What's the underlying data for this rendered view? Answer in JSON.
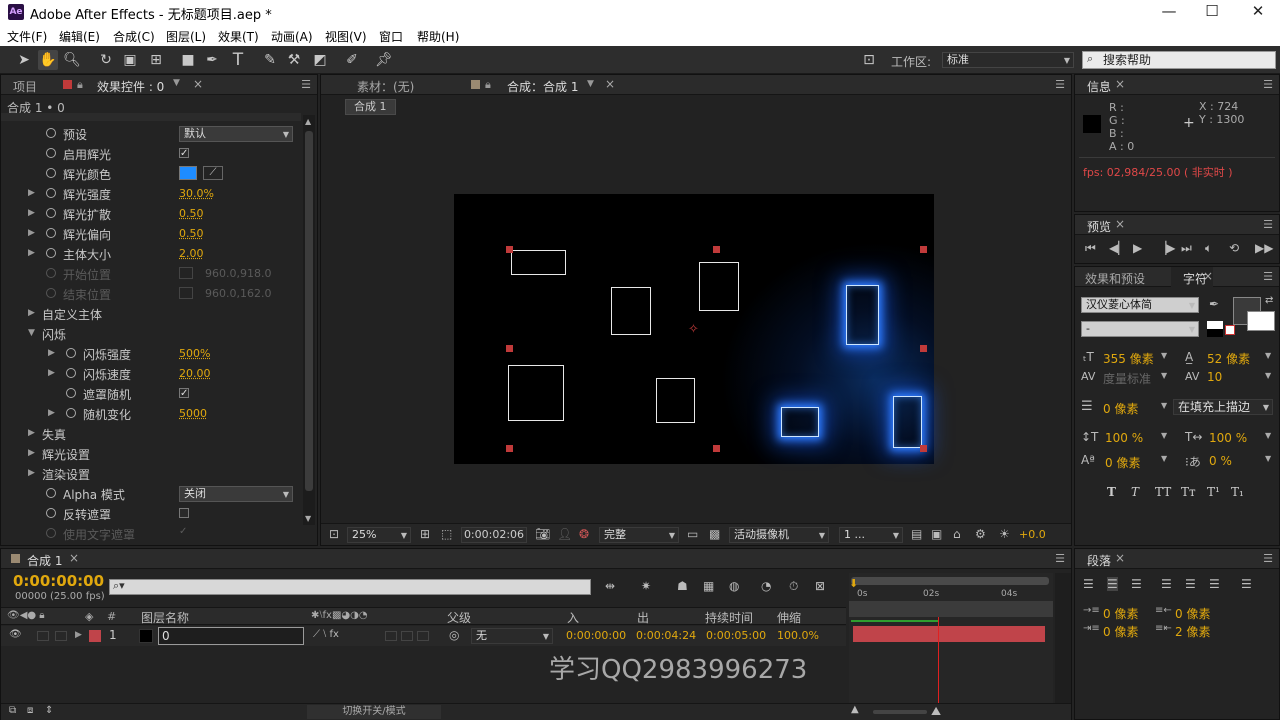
{
  "app": {
    "title": "Adobe After Effects - 无标题项目.aep *",
    "logo": "Ae"
  },
  "menu": [
    "文件(F)",
    "编辑(E)",
    "合成(C)",
    "图层(L)",
    "效果(T)",
    "动画(A)",
    "视图(V)",
    "窗口",
    "帮助(H)"
  ],
  "toolbar": {
    "workspace_label": "工作区:",
    "workspace_value": "标准",
    "search_placeholder": "搜索帮助"
  },
  "left_panel": {
    "tab_project": "项目",
    "tab_effects": "效果控件 : 0",
    "breadcrumb": "合成 1 • 0",
    "rows": {
      "preset": {
        "label": "预设",
        "value": "默认"
      },
      "enable_glow": {
        "label": "启用辉光"
      },
      "glow_color": {
        "label": "辉光颜色",
        "color": "#1e8cff"
      },
      "glow_intensity": {
        "label": "辉光强度",
        "value": "30.0%"
      },
      "glow_spread": {
        "label": "辉光扩散",
        "value": "0.50"
      },
      "glow_bias": {
        "label": "辉光偏向",
        "value": "0.50"
      },
      "core_size": {
        "label": "主体大小",
        "value": "2.00"
      },
      "start_pos": {
        "label": "开始位置",
        "value": "960.0,918.0"
      },
      "end_pos": {
        "label": "结束位置",
        "value": "960.0,162.0"
      },
      "custom_core": {
        "label": "自定义主体"
      },
      "flicker": {
        "label": "闪烁"
      },
      "flicker_intensity": {
        "label": "闪烁强度",
        "value": "500%"
      },
      "flicker_speed": {
        "label": "闪烁速度",
        "value": "20.00"
      },
      "mask_random": {
        "label": "遮罩随机"
      },
      "random_change": {
        "label": "随机变化",
        "value": "5000"
      },
      "distortion": {
        "label": "失真"
      },
      "glow_settings": {
        "label": "辉光设置"
      },
      "render_settings": {
        "label": "渲染设置"
      },
      "alpha_mode": {
        "label": "Alpha 模式",
        "value": "关闭"
      },
      "invert_mask": {
        "label": "反转遮罩"
      },
      "use_text_mask": {
        "label": "使用文字遮罩"
      }
    }
  },
  "viewer": {
    "tab_footage": "素材：(无)",
    "tab_comp": "合成：合成 1",
    "sub_tab": "合成 1",
    "zoom": "25%",
    "timecode": "0:00:02:06",
    "quality": "完整",
    "camera": "活动摄像机",
    "views": "1 ...",
    "exposure": "+0.0"
  },
  "info_panel": {
    "tab": "信息",
    "r": "R :",
    "g": "G :",
    "b": "B :",
    "a": "A : 0",
    "x": "X : 724",
    "y": "Y : 1300",
    "fps": "fps: 02,984/25.00 ( 非实时 )"
  },
  "preview_panel": {
    "tab": "预览"
  },
  "char_panel": {
    "tab_effects": "效果和预设",
    "tab_char": "字符",
    "font": "汉仪菱心体简",
    "style": "-",
    "size": "355 像素",
    "leading": "52 像素",
    "kerning": "度量标准",
    "tracking": "10",
    "stroke_width": "0 像素",
    "stroke_mode": "在填充上描边",
    "vscale": "100 %",
    "hscale": "100 %",
    "baseline": "0 像素",
    "tsume": "0 %",
    "styles": [
      "T",
      "T",
      "TT",
      "Tт",
      "T¹",
      "T₁"
    ]
  },
  "paragraph_panel": {
    "tab": "段落",
    "indent_left": "0 像素",
    "indent_right": "0 像素",
    "space_before": "0 像素",
    "space_after": "2 像素"
  },
  "timeline": {
    "tab": "合成 1",
    "timecode": "0:00:00:00",
    "frames": "00000 (25.00 fps)",
    "search_placeholder": "",
    "columns": {
      "num": "#",
      "layer_name": "图层名称",
      "parent": "父级",
      "in": "入",
      "out": "出",
      "duration": "持续时间",
      "stretch": "伸缩"
    },
    "layer": {
      "num": "1",
      "name": "0",
      "parent": "无",
      "in": "0:00:00:00",
      "out": "0:00:04:24",
      "duration": "0:00:05:00",
      "stretch": "100.0%",
      "color": "#c0444a"
    },
    "ruler": [
      "0s",
      "02s",
      "04s"
    ],
    "toggle_label": "切换开关/模式",
    "watermark": "学习QQ2983996273"
  }
}
